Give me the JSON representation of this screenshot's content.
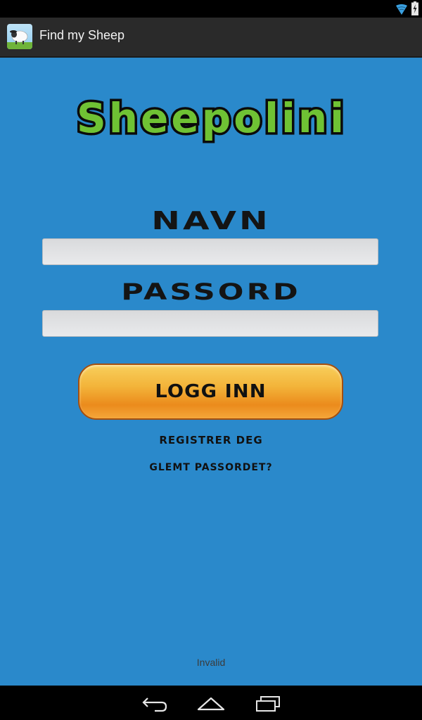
{
  "status_bar": {
    "icons": [
      "wifi-icon",
      "battery-charging-icon"
    ]
  },
  "action_bar": {
    "app_icon": "sheep-app-icon",
    "title": "Find my Sheep"
  },
  "login": {
    "logo_text": "Sheepolini",
    "username_label": "NAVN",
    "username_value": "",
    "password_label": "PASSORD",
    "password_value": "",
    "login_button_label": "LOGG INN",
    "register_link": "REGISTRER DEG",
    "forgot_password_link": "GLEMT PASSORDET?",
    "status_message": "Invalid"
  },
  "nav_bar": {
    "icons": [
      "back-icon",
      "home-icon",
      "recent-apps-icon"
    ]
  },
  "colors": {
    "background": "#2a89cb",
    "logo_green": "#6fc234",
    "button_orange": "#f3a42f",
    "action_bar": "#2a2a2a"
  }
}
